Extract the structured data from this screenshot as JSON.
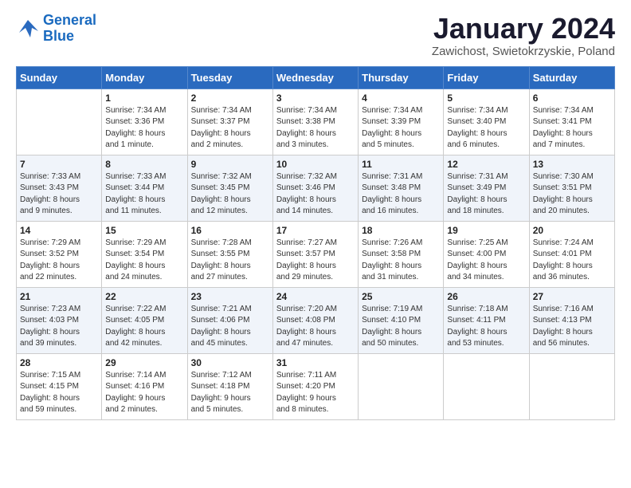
{
  "logo": {
    "line1": "General",
    "line2": "Blue"
  },
  "title": "January 2024",
  "subtitle": "Zawichost, Swietokrzyskie, Poland",
  "days_header": [
    "Sunday",
    "Monday",
    "Tuesday",
    "Wednesday",
    "Thursday",
    "Friday",
    "Saturday"
  ],
  "weeks": [
    [
      {
        "num": "",
        "info": ""
      },
      {
        "num": "1",
        "info": "Sunrise: 7:34 AM\nSunset: 3:36 PM\nDaylight: 8 hours\nand 1 minute."
      },
      {
        "num": "2",
        "info": "Sunrise: 7:34 AM\nSunset: 3:37 PM\nDaylight: 8 hours\nand 2 minutes."
      },
      {
        "num": "3",
        "info": "Sunrise: 7:34 AM\nSunset: 3:38 PM\nDaylight: 8 hours\nand 3 minutes."
      },
      {
        "num": "4",
        "info": "Sunrise: 7:34 AM\nSunset: 3:39 PM\nDaylight: 8 hours\nand 5 minutes."
      },
      {
        "num": "5",
        "info": "Sunrise: 7:34 AM\nSunset: 3:40 PM\nDaylight: 8 hours\nand 6 minutes."
      },
      {
        "num": "6",
        "info": "Sunrise: 7:34 AM\nSunset: 3:41 PM\nDaylight: 8 hours\nand 7 minutes."
      }
    ],
    [
      {
        "num": "7",
        "info": "Sunrise: 7:33 AM\nSunset: 3:43 PM\nDaylight: 8 hours\nand 9 minutes."
      },
      {
        "num": "8",
        "info": "Sunrise: 7:33 AM\nSunset: 3:44 PM\nDaylight: 8 hours\nand 11 minutes."
      },
      {
        "num": "9",
        "info": "Sunrise: 7:32 AM\nSunset: 3:45 PM\nDaylight: 8 hours\nand 12 minutes."
      },
      {
        "num": "10",
        "info": "Sunrise: 7:32 AM\nSunset: 3:46 PM\nDaylight: 8 hours\nand 14 minutes."
      },
      {
        "num": "11",
        "info": "Sunrise: 7:31 AM\nSunset: 3:48 PM\nDaylight: 8 hours\nand 16 minutes."
      },
      {
        "num": "12",
        "info": "Sunrise: 7:31 AM\nSunset: 3:49 PM\nDaylight: 8 hours\nand 18 minutes."
      },
      {
        "num": "13",
        "info": "Sunrise: 7:30 AM\nSunset: 3:51 PM\nDaylight: 8 hours\nand 20 minutes."
      }
    ],
    [
      {
        "num": "14",
        "info": "Sunrise: 7:29 AM\nSunset: 3:52 PM\nDaylight: 8 hours\nand 22 minutes."
      },
      {
        "num": "15",
        "info": "Sunrise: 7:29 AM\nSunset: 3:54 PM\nDaylight: 8 hours\nand 24 minutes."
      },
      {
        "num": "16",
        "info": "Sunrise: 7:28 AM\nSunset: 3:55 PM\nDaylight: 8 hours\nand 27 minutes."
      },
      {
        "num": "17",
        "info": "Sunrise: 7:27 AM\nSunset: 3:57 PM\nDaylight: 8 hours\nand 29 minutes."
      },
      {
        "num": "18",
        "info": "Sunrise: 7:26 AM\nSunset: 3:58 PM\nDaylight: 8 hours\nand 31 minutes."
      },
      {
        "num": "19",
        "info": "Sunrise: 7:25 AM\nSunset: 4:00 PM\nDaylight: 8 hours\nand 34 minutes."
      },
      {
        "num": "20",
        "info": "Sunrise: 7:24 AM\nSunset: 4:01 PM\nDaylight: 8 hours\nand 36 minutes."
      }
    ],
    [
      {
        "num": "21",
        "info": "Sunrise: 7:23 AM\nSunset: 4:03 PM\nDaylight: 8 hours\nand 39 minutes."
      },
      {
        "num": "22",
        "info": "Sunrise: 7:22 AM\nSunset: 4:05 PM\nDaylight: 8 hours\nand 42 minutes."
      },
      {
        "num": "23",
        "info": "Sunrise: 7:21 AM\nSunset: 4:06 PM\nDaylight: 8 hours\nand 45 minutes."
      },
      {
        "num": "24",
        "info": "Sunrise: 7:20 AM\nSunset: 4:08 PM\nDaylight: 8 hours\nand 47 minutes."
      },
      {
        "num": "25",
        "info": "Sunrise: 7:19 AM\nSunset: 4:10 PM\nDaylight: 8 hours\nand 50 minutes."
      },
      {
        "num": "26",
        "info": "Sunrise: 7:18 AM\nSunset: 4:11 PM\nDaylight: 8 hours\nand 53 minutes."
      },
      {
        "num": "27",
        "info": "Sunrise: 7:16 AM\nSunset: 4:13 PM\nDaylight: 8 hours\nand 56 minutes."
      }
    ],
    [
      {
        "num": "28",
        "info": "Sunrise: 7:15 AM\nSunset: 4:15 PM\nDaylight: 8 hours\nand 59 minutes."
      },
      {
        "num": "29",
        "info": "Sunrise: 7:14 AM\nSunset: 4:16 PM\nDaylight: 9 hours\nand 2 minutes."
      },
      {
        "num": "30",
        "info": "Sunrise: 7:12 AM\nSunset: 4:18 PM\nDaylight: 9 hours\nand 5 minutes."
      },
      {
        "num": "31",
        "info": "Sunrise: 7:11 AM\nSunset: 4:20 PM\nDaylight: 9 hours\nand 8 minutes."
      },
      {
        "num": "",
        "info": ""
      },
      {
        "num": "",
        "info": ""
      },
      {
        "num": "",
        "info": ""
      }
    ]
  ]
}
